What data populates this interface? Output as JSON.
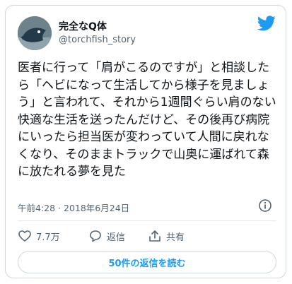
{
  "author": {
    "display_name": "完全なQ体",
    "handle": "@torchfish_story"
  },
  "tweet": {
    "text": "医者に行って「肩がこるのですが」と相談したら「ヘビになって生活してから様子を見ましょう」と言われて、それから1週間ぐらい肩のない快適な生活を送ったんだけど、その後再び病院にいったら担当医が変わっていて人間に戻れなくなり、そのままトラックで山奥に運ばれて森に放たれる夢を見た",
    "timestamp": "午前4:28 · 2018年6月24日"
  },
  "actions": {
    "like_count": "7.7万",
    "reply_label": "返信",
    "share_label": "共有"
  },
  "replies_button": {
    "label": "50件の返信を読む"
  },
  "colors": {
    "accent": "#1d9bf0",
    "muted": "#536471",
    "border": "#cfd9de"
  },
  "icons": {
    "platform": "twitter-bird-icon",
    "info": "info-icon",
    "like": "heart-icon",
    "reply": "reply-bubble-icon",
    "share": "share-icon"
  }
}
